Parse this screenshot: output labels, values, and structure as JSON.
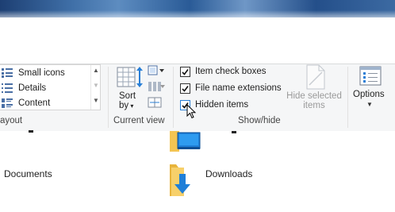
{
  "ribbon": {
    "layout": {
      "items": [
        {
          "label": "Small icons",
          "icon": "small-icons-icon"
        },
        {
          "label": "Details",
          "icon": "details-icon"
        },
        {
          "label": "Content",
          "icon": "content-icon"
        }
      ],
      "group_label": "ayout"
    },
    "current_view": {
      "sort_label_1": "Sort",
      "sort_label_2": "by",
      "group_label": "Current view"
    },
    "show_hide": {
      "checkboxes": [
        {
          "label": "Item check boxes",
          "checked": true
        },
        {
          "label": "File name extensions",
          "checked": true
        },
        {
          "label": "Hidden items",
          "checked": true
        }
      ],
      "hide_selected_line1": "Hide selected",
      "hide_selected_line2": "items",
      "group_label": "Show/hide"
    },
    "options": {
      "label": "Options"
    }
  },
  "files": [
    {
      "name": "Documents",
      "icon": "documents-folder-icon"
    },
    {
      "name": "Downloads",
      "icon": "downloads-folder-icon"
    }
  ],
  "colors": {
    "ribbon_bg": "#f5f6f7",
    "accent_blue": "#2a7fd6",
    "folder_yellow": "#f3c453"
  }
}
